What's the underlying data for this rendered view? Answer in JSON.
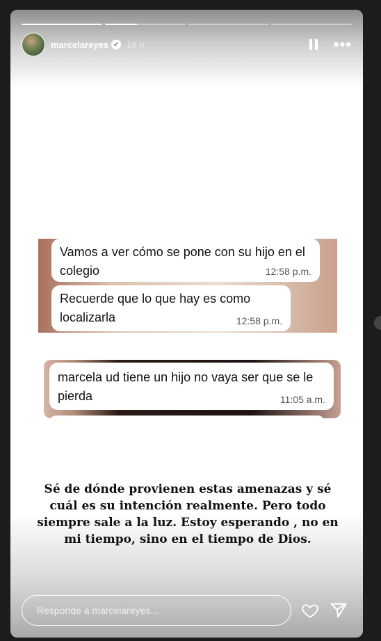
{
  "header": {
    "username": "marcelareyes",
    "time": "19 h",
    "verified_icon": "verified-badge-icon",
    "pause_icon": "pause-icon",
    "more_icon": "more-options-icon"
  },
  "progress": {
    "segments": 4,
    "current": 2
  },
  "messages_group1": [
    {
      "text": "Vamos a ver cómo se pone con su hijo en el colegio",
      "time": "12:58 p.m."
    },
    {
      "text": "Recuerde que lo que hay es como localizarla",
      "time": "12:58 p.m."
    }
  ],
  "messages_group2": [
    {
      "text": "marcela ud tiene un hijo no vaya ser que se le pierda",
      "time": "11:05 a.m."
    }
  ],
  "caption": "Sé de dónde provienen estas amenazas y sé cuál es su intención realmente. Pero todo siempre sale a la luz. Estoy esperando , no en mi tiempo, sino en el tiempo de Dios.",
  "footer": {
    "reply_placeholder": "Responde a marcelareyes...",
    "like_icon": "heart-icon",
    "send_icon": "send-icon"
  }
}
